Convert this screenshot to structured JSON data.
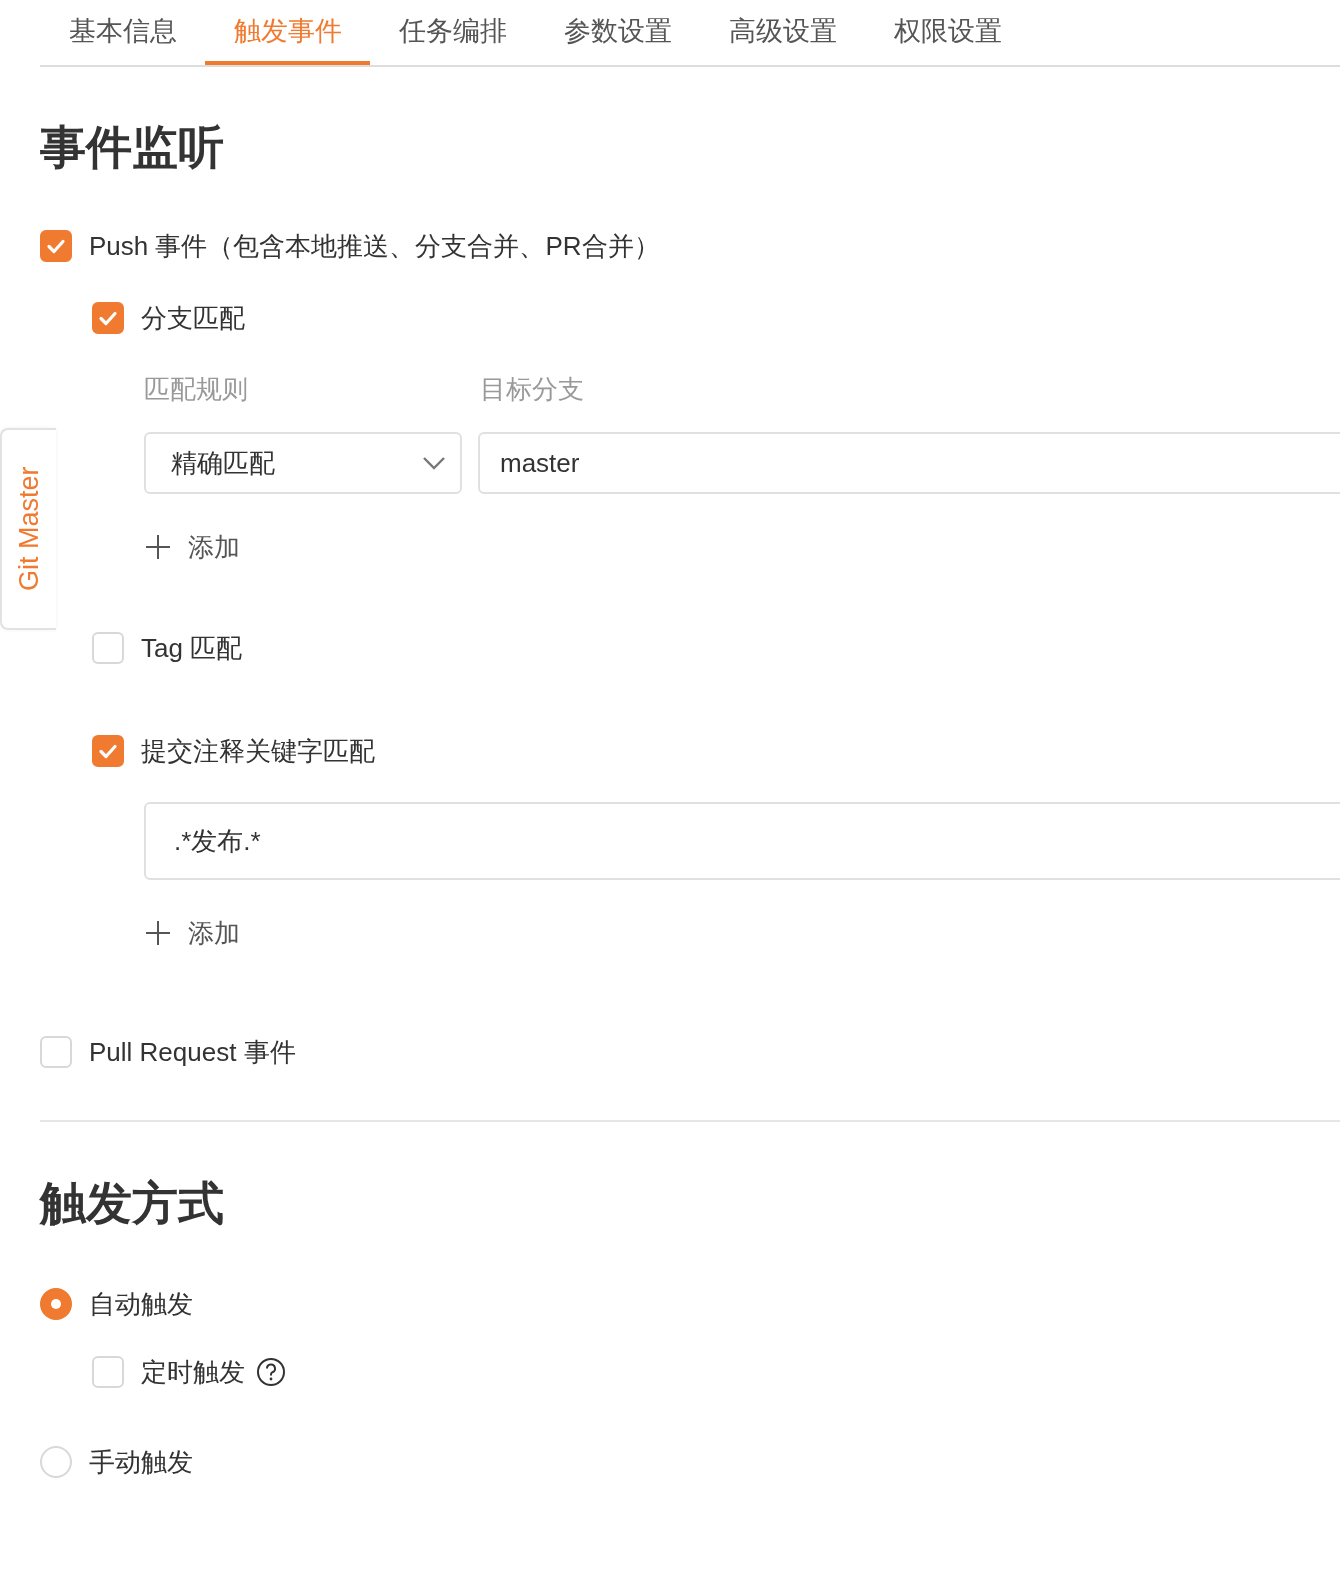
{
  "tabs": [
    {
      "label": "基本信息",
      "selected": false
    },
    {
      "label": "触发事件",
      "selected": true
    },
    {
      "label": "任务编排",
      "selected": false
    },
    {
      "label": "参数设置",
      "selected": false
    },
    {
      "label": "高级设置",
      "selected": false
    },
    {
      "label": "权限设置",
      "selected": false
    }
  ],
  "side_tab": {
    "label": "Git Master"
  },
  "event_section": {
    "title": "事件监听",
    "events": [
      {
        "label": "Push 事件（包含本地推送、分支合并、PR合并）",
        "checked": true,
        "filters": [
          {
            "kind": "branch",
            "label": "分支匹配",
            "checked": true,
            "columns": [
              "匹配规则",
              "目标分支"
            ],
            "rules": [
              {
                "match": "精确匹配",
                "target": "master"
              }
            ],
            "add_label": "添加"
          },
          {
            "kind": "tag",
            "label": "Tag 匹配",
            "checked": false
          },
          {
            "kind": "keyword",
            "label": "提交注释关键字匹配",
            "checked": true,
            "keywords": [
              ".*发布.*"
            ],
            "add_label": "添加"
          }
        ]
      },
      {
        "label": "Pull Request 事件",
        "checked": false
      }
    ]
  },
  "trigger_section": {
    "title": "触发方式",
    "modes": [
      {
        "label": "自动触发",
        "selected": true,
        "options": [
          {
            "label": "定时触发",
            "checked": false,
            "help": true
          }
        ]
      },
      {
        "label": "手动触发",
        "selected": false
      }
    ]
  }
}
